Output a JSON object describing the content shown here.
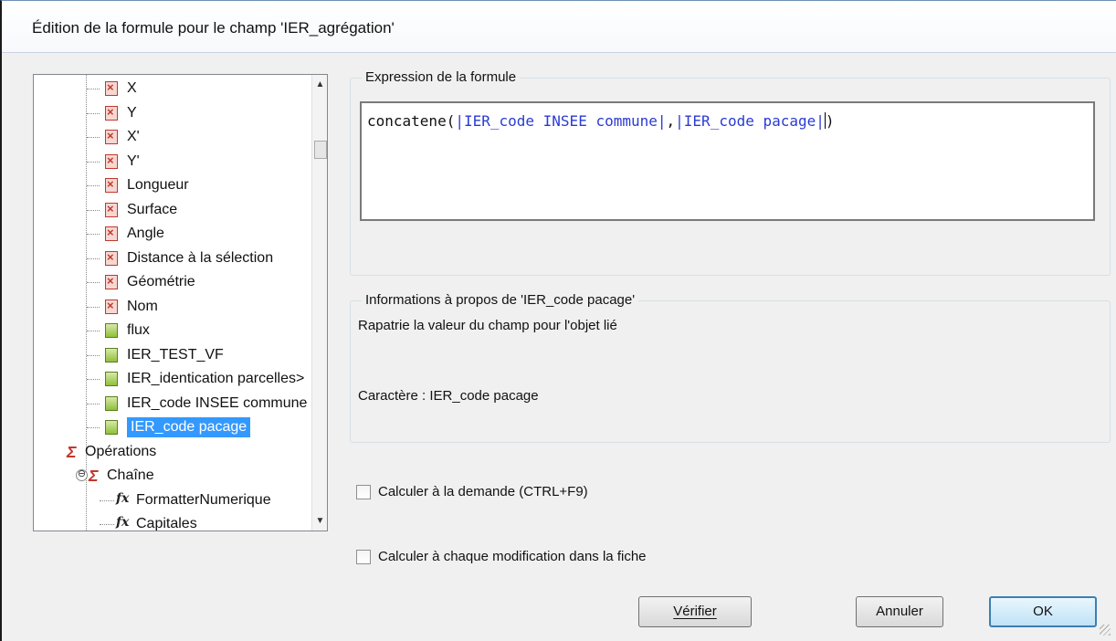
{
  "window": {
    "title": "Édition de la formule pour le champ 'IER_agrégation'"
  },
  "tree": {
    "items": [
      {
        "label": "X",
        "icon": "red-field-icon"
      },
      {
        "label": "Y",
        "icon": "red-field-icon"
      },
      {
        "label": "X'",
        "icon": "red-field-icon"
      },
      {
        "label": "Y'",
        "icon": "red-field-icon"
      },
      {
        "label": "Longueur",
        "icon": "red-field-icon"
      },
      {
        "label": "Surface",
        "icon": "red-field-icon"
      },
      {
        "label": "Angle",
        "icon": "red-field-icon"
      },
      {
        "label": "Distance à la sélection",
        "icon": "red-field-icon"
      },
      {
        "label": "Géométrie",
        "icon": "red-field-icon"
      },
      {
        "label": "Nom",
        "icon": "red-field-icon"
      },
      {
        "label": "flux",
        "icon": "green-field-icon"
      },
      {
        "label": "IER_TEST_VF",
        "icon": "green-field-icon"
      },
      {
        "label": "IER_identication parcelles>",
        "icon": "green-field-icon"
      },
      {
        "label": "IER_code INSEE commune",
        "icon": "green-field-icon"
      },
      {
        "label": "IER_code pacage",
        "icon": "green-field-icon",
        "selected": true
      },
      {
        "label": "Opérations",
        "icon": "sigma-icon"
      },
      {
        "label": "Chaîne",
        "icon": "sigma-icon",
        "expander": "⊖"
      },
      {
        "label": "FormatterNumerique",
        "icon": "fx-icon"
      },
      {
        "label": "Capitales",
        "icon": "fx-icon"
      }
    ],
    "fx_glyph": "fx",
    "sigma_glyph": "Σ"
  },
  "expression": {
    "group_label": "Expression de la formule",
    "fn_open": "concatene(",
    "ref1": "|IER_code INSEE commune|",
    "comma": ",",
    "ref2": "|IER_code pacage|",
    "fn_close": ")"
  },
  "info": {
    "group_label": "Informations à propos de 'IER_code pacage'",
    "description": "Rapatrie la valeur du champ pour l'objet lié",
    "type_line": "Caractère : IER_code pacage"
  },
  "options": {
    "on_demand": {
      "label": "Calculer à la demande (CTRL+F9)",
      "checked": false
    },
    "on_change": {
      "label": "Calculer à chaque modification dans la fiche",
      "checked": false
    }
  },
  "buttons": {
    "verify": "Vérifier",
    "cancel": "Annuler",
    "ok": "OK"
  },
  "scrollbar": {
    "up_arrow": "▲",
    "down_arrow": "▼"
  },
  "colors": {
    "selection": "#3399ff",
    "field_ref": "#2a3bd4",
    "error_icon": "#c0392b",
    "field_icon": "#8fbf3a"
  }
}
